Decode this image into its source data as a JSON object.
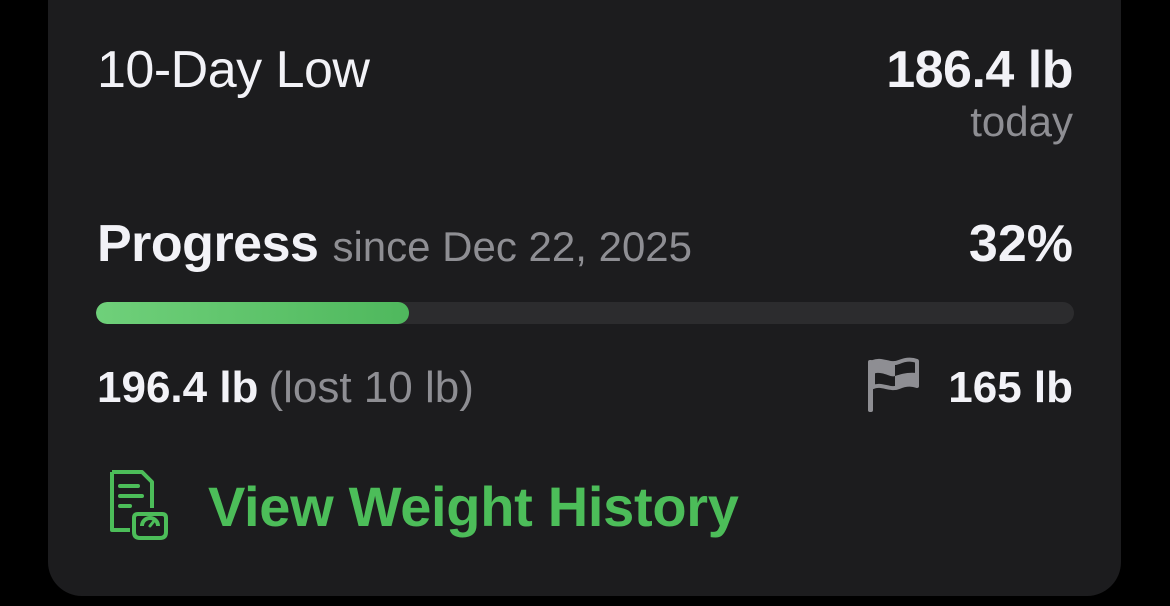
{
  "low": {
    "label": "10-Day Low",
    "value": "186.4 lb",
    "when": "today"
  },
  "progress": {
    "label": "Progress",
    "since": "since Dec 22, 2025",
    "percent_text": "32%",
    "fraction": 0.32
  },
  "weights": {
    "start": "196.4 lb",
    "lost": "(lost 10 lb)",
    "goal": "165 lb"
  },
  "history_link": {
    "label": "View Weight History",
    "icon": "weight-log-icon"
  },
  "colors": {
    "accent": "#4cbd59",
    "card": "#1c1c1e",
    "track": "#2c2c2e",
    "secondary_text": "#8e8e93"
  }
}
